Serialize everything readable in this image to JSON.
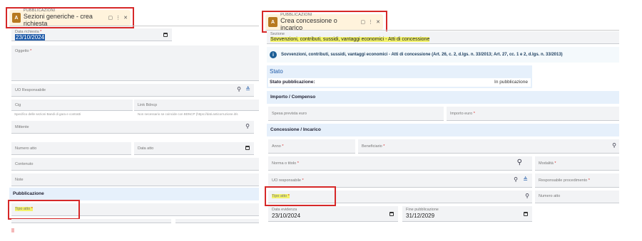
{
  "left": {
    "tab": {
      "small": "PUBBLICAZIONI",
      "title": "Sezioni generiche - crea richiesta",
      "icons": [
        "tab-copy-icon",
        "more-vert-icon",
        "close-icon"
      ]
    },
    "data_richiesta": {
      "label": "Data richiesta",
      "value": "23/10/2024"
    },
    "oggetto": {
      "label": "Oggetto"
    },
    "uo": {
      "label": "UO Responsabile"
    },
    "cig": {
      "label": "Cig",
      "helper": "Specifico delle sezioni Bandi di gara e contratti"
    },
    "bdncp": {
      "label": "Link Bdncp",
      "helper": "Non necessario se coincide con BDNCP (https://dati.anticorruzione.it/s"
    },
    "mittente": {
      "label": "Mittente"
    },
    "numero_atto": {
      "label": "Numero atto"
    },
    "data_atto": {
      "label": "Data atto"
    },
    "contenuto": {
      "label": "Contenuto"
    },
    "note": {
      "label": "Note"
    },
    "pubblicazione": {
      "title": "Pubblicazione"
    },
    "tipo_atto": {
      "label": "Tipo atto"
    }
  },
  "right": {
    "tab": {
      "small": "PUBBLICAZIONI",
      "title": "Crea concessione o incarico"
    },
    "sezione": {
      "label": "Sezione",
      "value": "Sovvenzioni, contributi, sussidi, vantaggi economici - Atti di concessione"
    },
    "info": "Sovvenzioni, contributi, sussidi, vantaggi economici - Atti di concessione (Art. 26, c. 2, d.lgs. n. 33/2013; Art. 27, cc. 1 e 2, d.lgs. n. 33/2013)",
    "stato": {
      "title": "Stato",
      "label": "Stato pubblicazione:",
      "value": "In pubblicazione"
    },
    "importo": {
      "title": "Importo / Compenso",
      "spesa": "Spesa prevista euro",
      "importo": "Importo euro"
    },
    "concessione": {
      "title": "Concessione / Incarico",
      "anno": "Anno",
      "beneficiario": "Beneficiario",
      "norma": "Norma o titolo",
      "modalita": "Modalità",
      "uo": "UO responsabile",
      "resp": "Responsabile procedimento",
      "tipo_atto": "Tipo atto",
      "numero_atto": "Numero atto"
    },
    "data_evidenza": {
      "label": "Data evidenza",
      "value": "23/10/2024"
    },
    "fine_pub": {
      "label": "Fine pubblicazione",
      "value": "31/12/2029"
    }
  }
}
